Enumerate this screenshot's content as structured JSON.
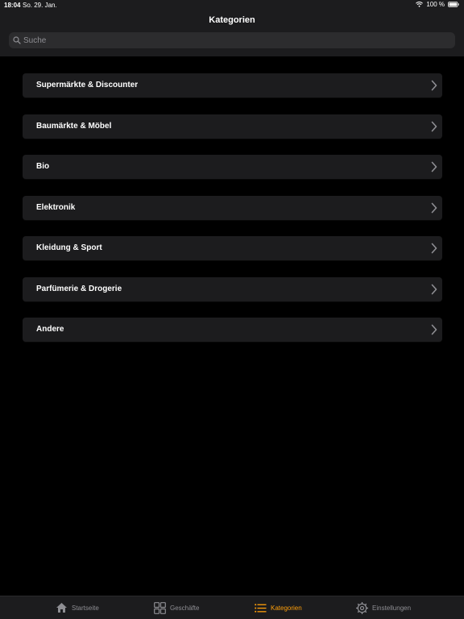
{
  "status_bar": {
    "time": "18:04",
    "date": "So. 29. Jan.",
    "battery": "100 %"
  },
  "header": {
    "title": "Kategorien"
  },
  "search": {
    "placeholder": "Suche"
  },
  "categories": [
    {
      "label": "Supermärkte & Discounter"
    },
    {
      "label": "Baumärkte & Möbel"
    },
    {
      "label": "Bio"
    },
    {
      "label": "Elektronik"
    },
    {
      "label": "Kleidung & Sport"
    },
    {
      "label": "Parfümerie & Drogerie"
    },
    {
      "label": "Andere"
    }
  ],
  "tab_bar": {
    "tabs": [
      {
        "label": "Startseite",
        "icon": "house-icon",
        "active": false
      },
      {
        "label": "Geschäfte",
        "icon": "grid-icon",
        "active": false
      },
      {
        "label": "Kategorien",
        "icon": "list-icon",
        "active": true
      },
      {
        "label": "Einstellungen",
        "icon": "gear-icon",
        "active": false
      }
    ]
  },
  "colors": {
    "background": "#000000",
    "surface": "#1c1c1e",
    "accent": "#ff9f0a",
    "inactive": "#8e8e93"
  }
}
